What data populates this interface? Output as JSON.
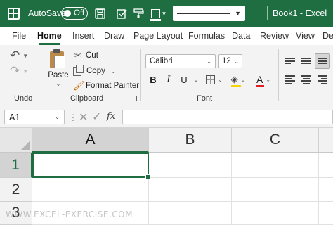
{
  "titlebar": {
    "autosave_label": "AutoSave",
    "toggle_state": "Off",
    "window_title": "Book1 - Excel",
    "accent_color": "#1e6e42"
  },
  "tabs": [
    "File",
    "Home",
    "Insert",
    "Draw",
    "Page Layout",
    "Formulas",
    "Data",
    "Review",
    "View",
    "Dev"
  ],
  "active_tab": "Home",
  "ribbon": {
    "undo_group_label": "Undo",
    "clipboard": {
      "paste_label": "Paste",
      "cut_label": "Cut",
      "copy_label": "Copy",
      "format_painter_label": "Format Painter",
      "group_label": "Clipboard"
    },
    "font": {
      "font_name": "Calibri",
      "font_size": "12",
      "bold": "B",
      "italic": "I",
      "underline": "U",
      "group_label": "Font",
      "fill_color": "#f5d400",
      "font_color": "#e02020"
    }
  },
  "formula_bar": {
    "name_box": "A1",
    "fx_label": "fx",
    "formula_value": ""
  },
  "sheet": {
    "columns": [
      "A",
      "B",
      "C"
    ],
    "rows": [
      "1",
      "2",
      "3"
    ],
    "active_cell": "A1"
  },
  "watermark": "WWW.EXCEL-EXERCISE.COM"
}
